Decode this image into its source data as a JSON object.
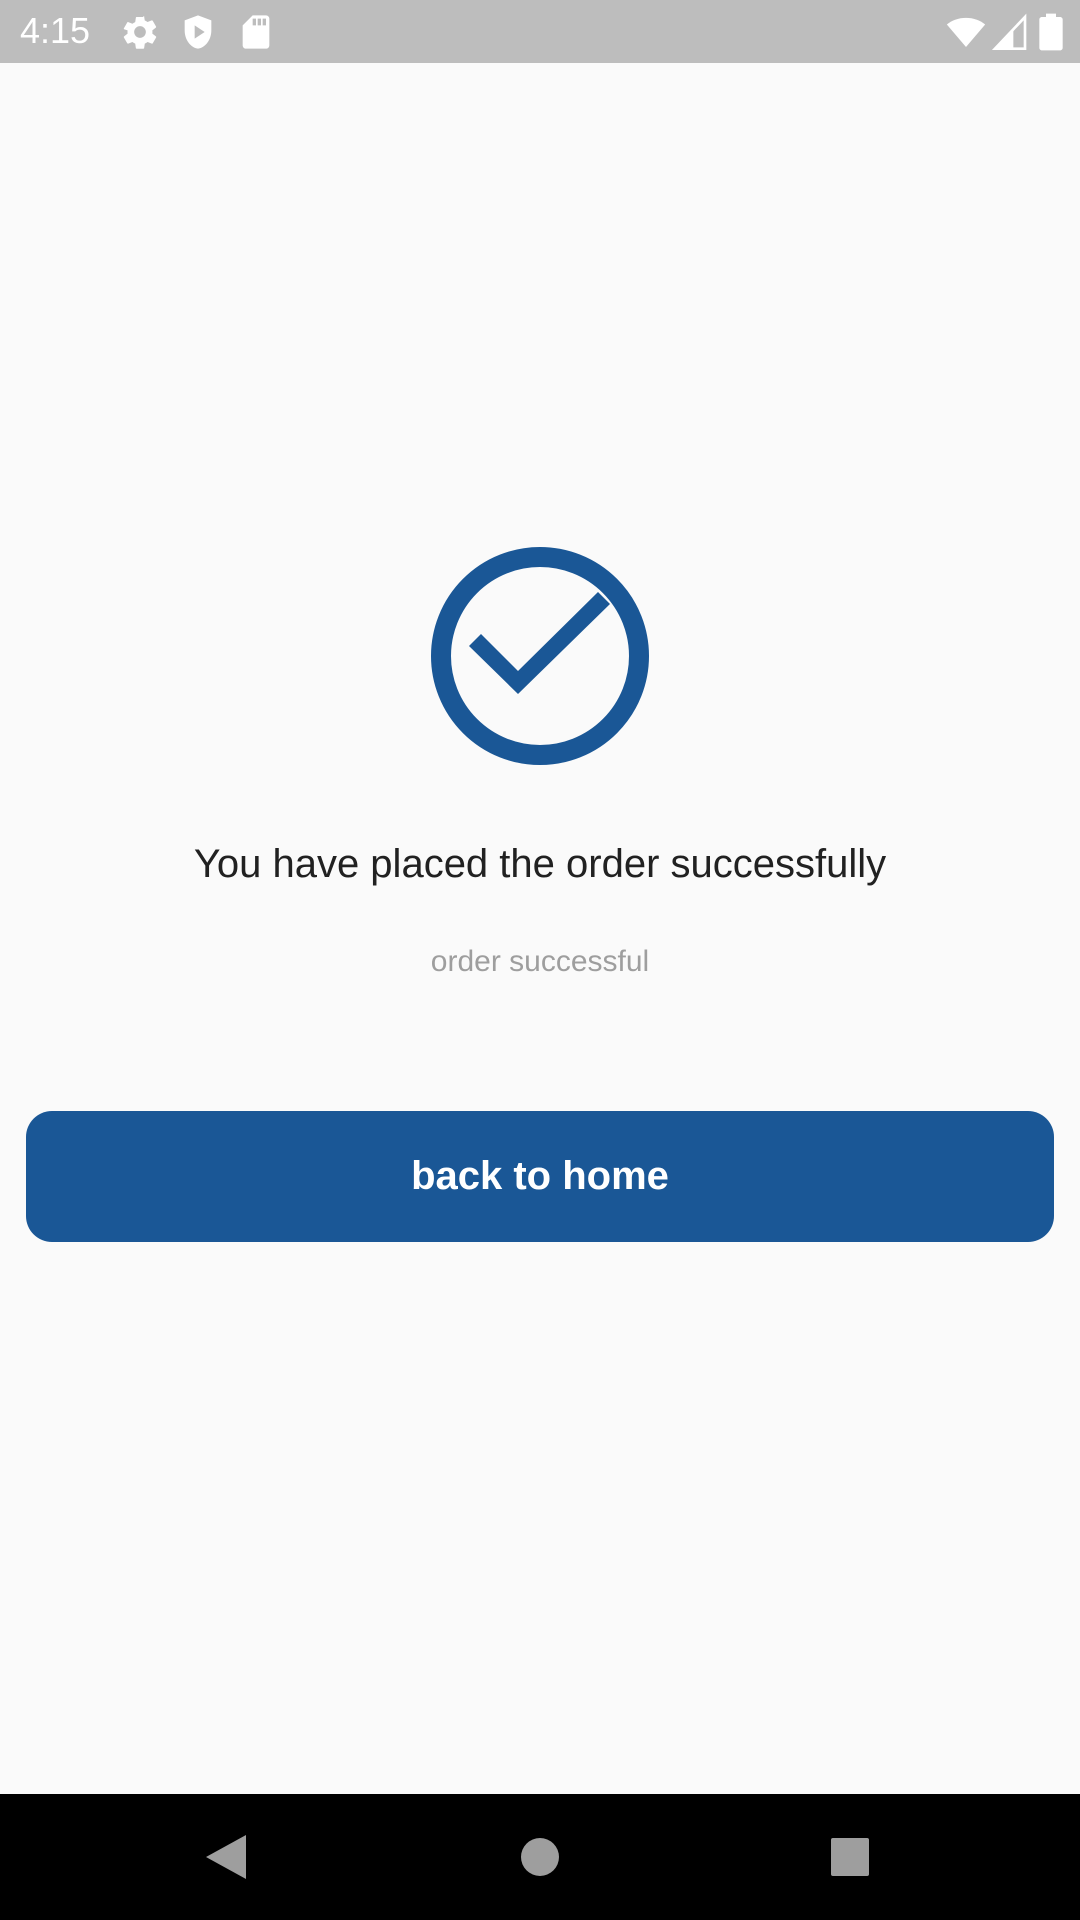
{
  "status_bar": {
    "time": "4:15",
    "icons": [
      "gear-icon",
      "shield-play-icon",
      "sd-card-icon",
      "wifi-icon",
      "signal-icon",
      "battery-icon"
    ]
  },
  "success": {
    "icon": "check-circle-icon",
    "title": "You have placed the order successfully",
    "subtitle": "order successful"
  },
  "actions": {
    "back_home_label": "back to home"
  },
  "nav_bar": {
    "buttons": [
      "back-triangle-icon",
      "home-circle-icon",
      "recents-square-icon"
    ]
  },
  "colors": {
    "primary": "#1a5796",
    "background": "#fafafa",
    "status_bar": "#bdbdbd",
    "title_text": "#212121",
    "subtitle_text": "#9e9e9e"
  }
}
